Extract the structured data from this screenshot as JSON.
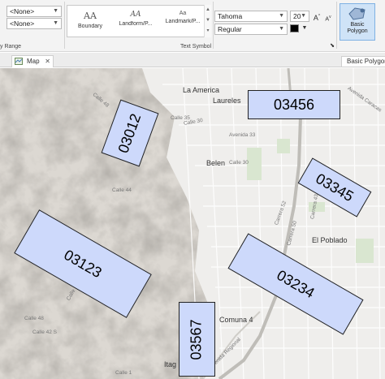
{
  "ribbon": {
    "combo1": "<None>",
    "combo2": "<None>",
    "range_label": "y Range",
    "gallery": [
      {
        "sample": "AA",
        "label": "Boundary"
      },
      {
        "sample": "AA",
        "label": "Landform/P..."
      },
      {
        "sample": "Aa",
        "label": "Landmark/P..."
      }
    ],
    "text_symbol_label": "Text Symbol",
    "font_name": "Tahoma",
    "font_size": "20",
    "font_style": "Regular",
    "grow_font": "A",
    "shrink_font": "A",
    "symbol_color": "#000000",
    "basic_polygon_label": "Basic Polygon",
    "icons": {
      "font_size_up": "font-size-increase-icon",
      "font_size_down": "font-size-decrease-icon",
      "color_dropdown": "chevron-down-icon",
      "polygon": "polygon-symbol-icon",
      "dialog_launcher": "dialog-launcher-icon"
    }
  },
  "tabs": {
    "map_tab": "Map",
    "right_tab": "Basic Polygon"
  },
  "map": {
    "places": {
      "la_america": "La America",
      "laureles": "Laureles",
      "belen": "Belen",
      "el_poblado": "El Poblado",
      "comuna4": "Comuna 4",
      "itag": "Itag"
    },
    "streets": {
      "avenida33": "Avenida 33",
      "calle35": "Calle 35",
      "calle30": "Calle 30",
      "calle30b": "Calle 30",
      "calle44": "Calle 44",
      "calle48": "Calle 48",
      "carrera52": "Carrera 52",
      "carrera50": "Carrera 50",
      "carrera43a": "Carrera 43A",
      "avenida_caracas": "Avenida Caracas",
      "calle42": "Calle 42 S",
      "calle48s": "Calle 48",
      "calle22": "Calle 22",
      "avenida_regional": "Avenida Regional",
      "calle1": "Calle 1"
    },
    "polygons": {
      "p03012": "03012",
      "p03456": "03456",
      "p03345": "03345",
      "p03123": "03123",
      "p03234": "03234",
      "p03567": "03567"
    },
    "polygon_fill": "#cdd9fb"
  }
}
